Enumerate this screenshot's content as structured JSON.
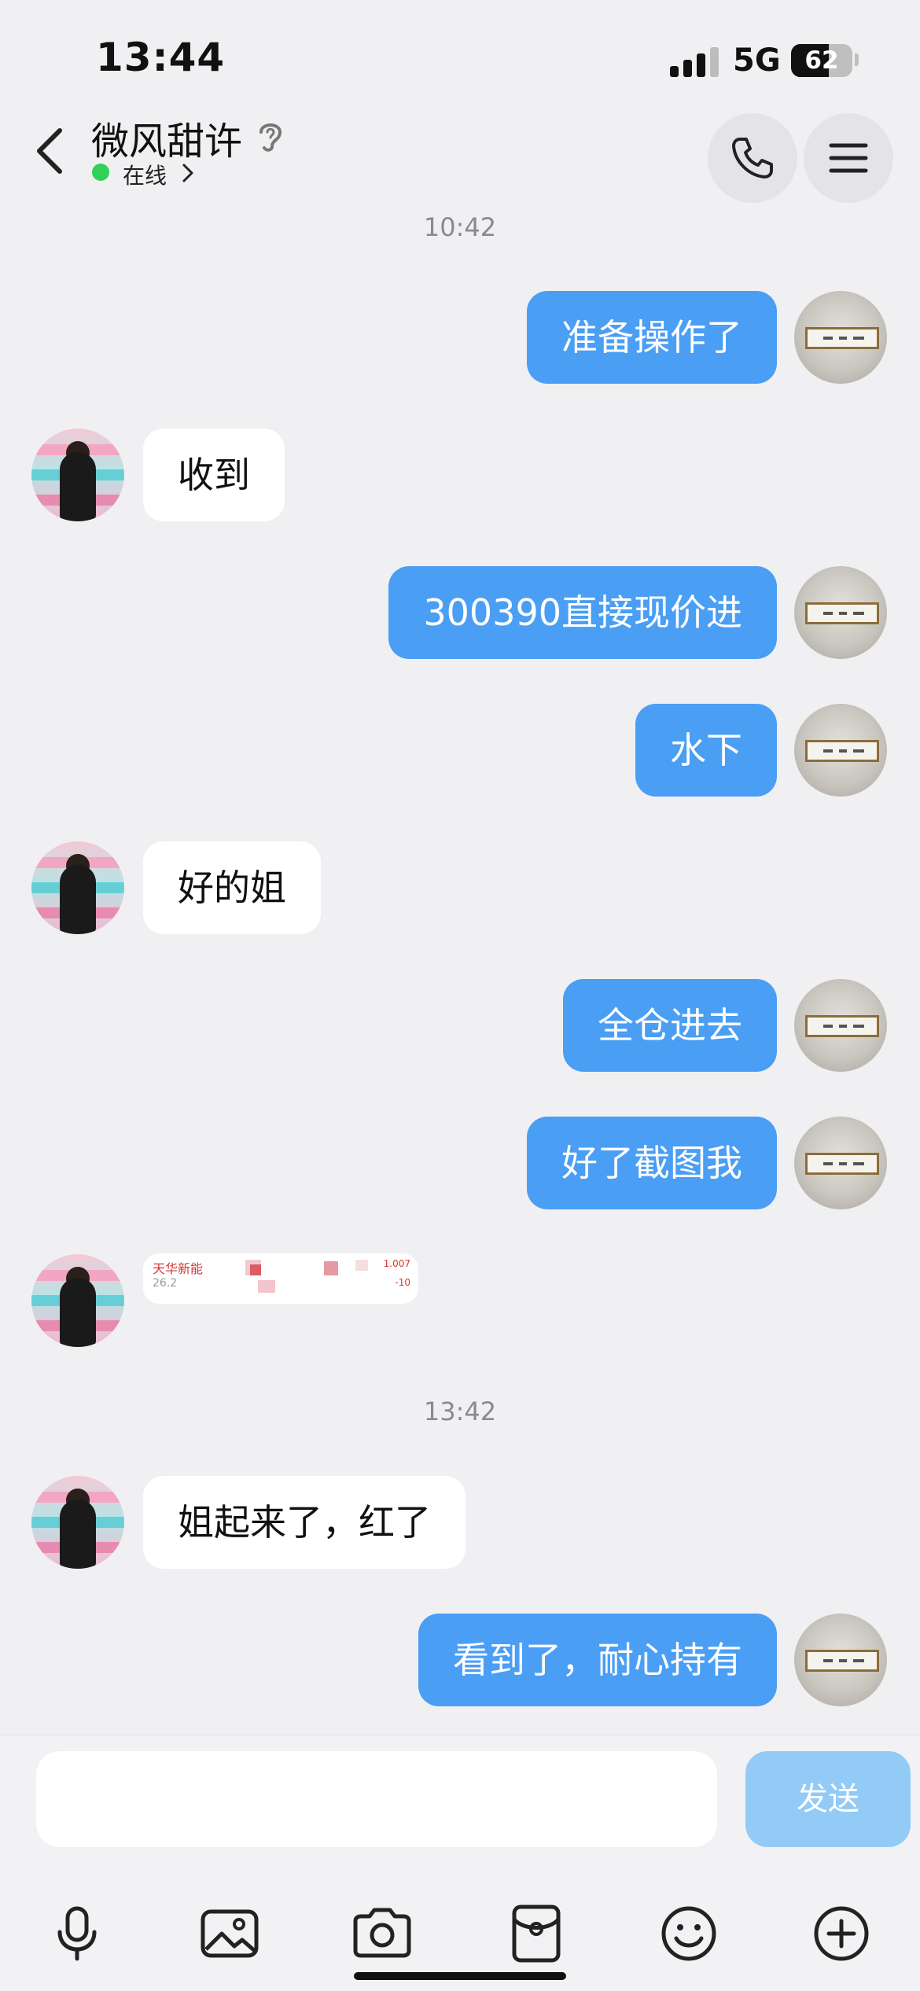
{
  "status_bar": {
    "time": "13:44",
    "network": "5G",
    "battery": "62",
    "battery_level": 0.62
  },
  "header": {
    "name": "微风甜许",
    "status": "在线"
  },
  "messages": [
    {
      "type": "timestamp",
      "text": "10:42"
    },
    {
      "type": "out",
      "text": "准备操作了"
    },
    {
      "type": "in",
      "text": "收到"
    },
    {
      "type": "out",
      "text": "300390直接现价进"
    },
    {
      "type": "out",
      "text": "水下"
    },
    {
      "type": "in",
      "text": "好的姐"
    },
    {
      "type": "out",
      "text": "全仓进去"
    },
    {
      "type": "out",
      "text": "好了截图我"
    },
    {
      "type": "in-image",
      "texts": [
        "天华新能",
        "26.2",
        "1.007",
        "-10"
      ]
    },
    {
      "type": "timestamp",
      "text": "13:42"
    },
    {
      "type": "in",
      "text": "姐起来了，红了"
    },
    {
      "type": "out",
      "text": "看到了，耐心持有"
    }
  ],
  "composer": {
    "placeholder": "",
    "send_label": "发送"
  },
  "toolbar": [
    "microphone-icon",
    "image-icon",
    "camera-icon",
    "red-packet-icon",
    "emoji-icon",
    "plus-icon"
  ],
  "colors": {
    "outgoing_bubble": "#4a9ef4",
    "incoming_bubble": "#ffffff",
    "send_button": "#92cbf6",
    "online": "#2fd158",
    "background": "#f0f0f2"
  }
}
